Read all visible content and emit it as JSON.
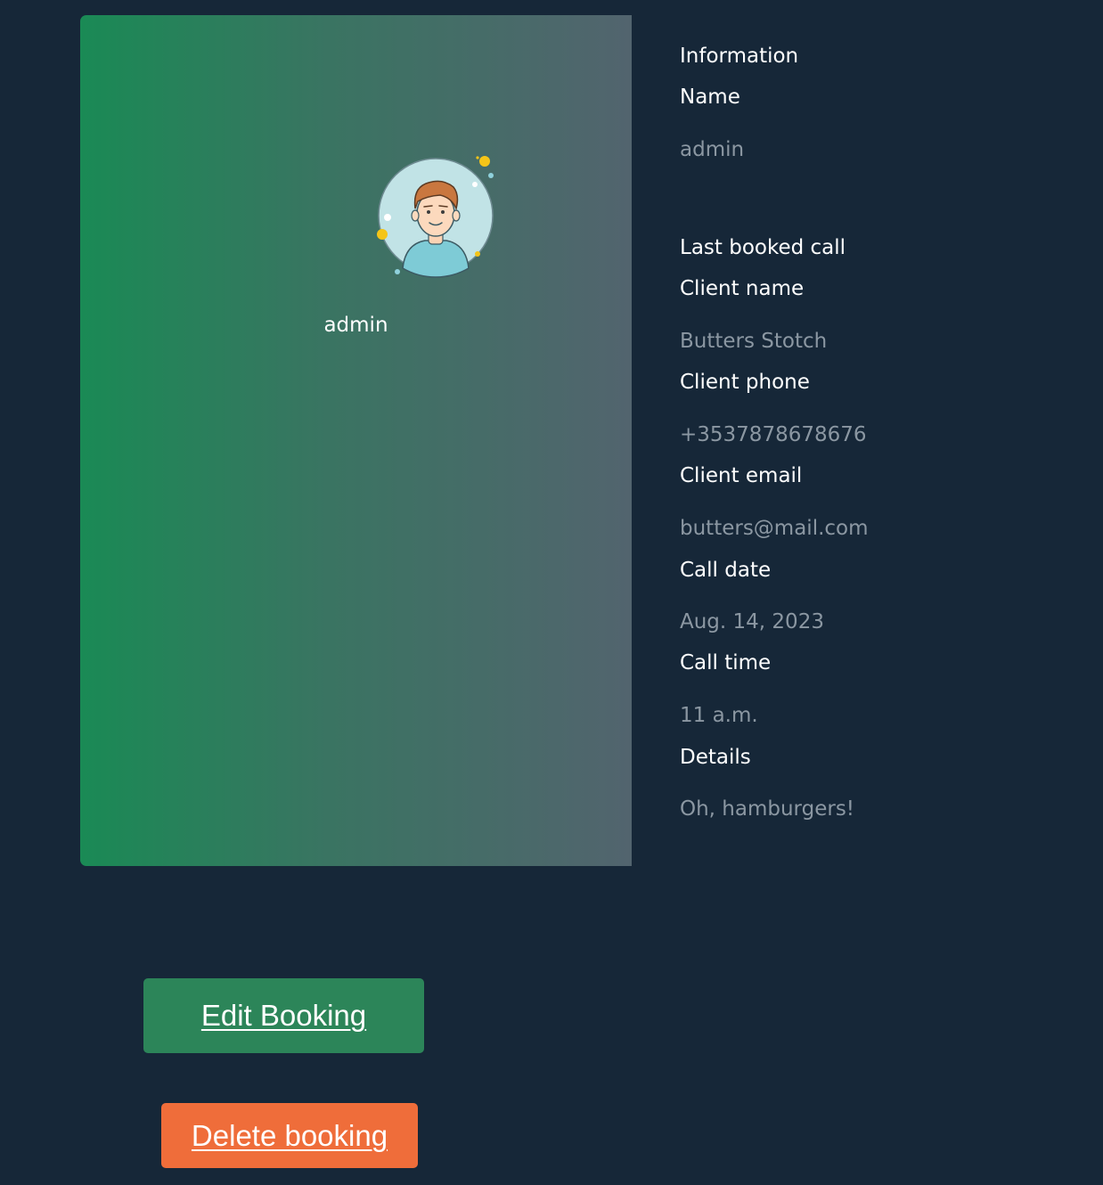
{
  "profile": {
    "username": "admin",
    "avatar_icon": "user-avatar-icon"
  },
  "info": {
    "heading": "Information",
    "name_label": "Name",
    "name_value": "admin"
  },
  "last_call": {
    "heading": "Last booked call",
    "fields": [
      {
        "label": "Client name",
        "value": "Butters Stotch"
      },
      {
        "label": "Client phone",
        "value": "+3537878678676"
      },
      {
        "label": "Client email",
        "value": "butters@mail.com"
      },
      {
        "label": "Call date",
        "value": "Aug. 14, 2023"
      },
      {
        "label": "Call time",
        "value": "11 a.m."
      },
      {
        "label": "Details",
        "value": "Oh, hamburgers!"
      }
    ]
  },
  "actions": {
    "edit_label": "Edit Booking",
    "delete_label": "Delete booking"
  },
  "colors": {
    "background": "#162738",
    "edit_button": "#2c8559",
    "delete_button": "#ef6d3a",
    "muted_text": "#8b97a2"
  }
}
